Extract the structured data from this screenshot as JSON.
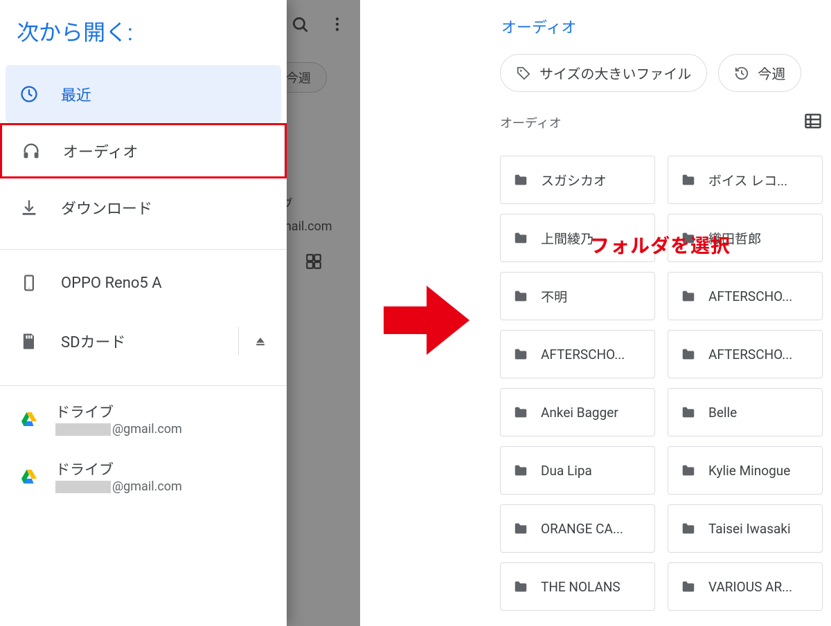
{
  "left": {
    "drawer_title": "次から開く:",
    "items": {
      "recent": "最近",
      "audio": "オーディオ",
      "downloads": "ダウンロード",
      "device": "OPPO Reno5 A",
      "sdcard": "SDカード"
    },
    "accounts": [
      {
        "label": "ドライブ",
        "suffix": "@gmail.com"
      },
      {
        "label": "ドライブ",
        "suffix": "@gmail.com"
      }
    ],
    "behind": {
      "chip": "今週",
      "acct_label": "ブ",
      "acct_mail": "mail.com"
    }
  },
  "right": {
    "breadcrumb": "オーディオ",
    "chips": {
      "large_files": "サイズの大きいファイル",
      "this_week": "今週"
    },
    "section_label": "オーディオ",
    "callout": "フォルダを選択",
    "folders": [
      "スガシカオ",
      "ボイス レコ...",
      "上間綾乃",
      "織田哲郎",
      "不明",
      "AFTERSCHO...",
      "AFTERSCHO...",
      "AFTERSCHO...",
      "Ankei Bagger",
      "Belle",
      "Dua Lipa",
      "Kylie Minogue",
      "ORANGE CA...",
      "Taisei Iwasaki",
      "THE NOLANS",
      "VARIOUS AR..."
    ]
  }
}
